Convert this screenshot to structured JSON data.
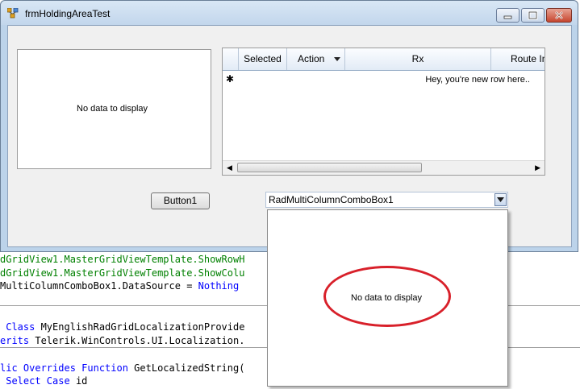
{
  "window": {
    "title": "frmHoldingAreaTest"
  },
  "left_grid": {
    "empty_text": "No data to display"
  },
  "right_grid": {
    "columns": [
      "Selected",
      "Action",
      "Rx",
      "Route In"
    ],
    "new_row_text": "Hey, you're new row here.."
  },
  "button1": {
    "label": "Button1"
  },
  "combo": {
    "text": "RadMultiColumnComboBox1",
    "dropdown_empty_text": "No data to display"
  },
  "code_lines": [
    {
      "a": "dGridView1.MasterGridViewTemplate.ShowRowH"
    },
    {
      "a": "dGridView1.MasterGridViewTemplate.ShowColu"
    },
    {
      "a": "MultiColumnComboBox1.DataSource = ",
      "b": "Nothing"
    },
    {
      "k1": "Class",
      "a": " MyEnglishRadGridLocalizationProvide"
    },
    {
      "k1": "erits",
      "a": " Telerik.WinControls.UI.Localization."
    },
    {
      "k1": "lic Overrides Function",
      "a": " GetLocalizedString("
    },
    {
      "k1": "Select Case",
      "a": " id"
    }
  ]
}
